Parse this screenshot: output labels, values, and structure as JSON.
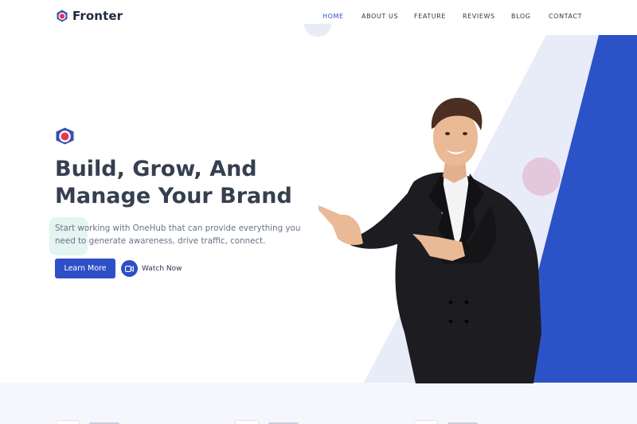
{
  "brand": {
    "name": "Fronter",
    "icon": "hexagon-logo-icon"
  },
  "nav": {
    "items": [
      {
        "label": "HOME",
        "active": true
      },
      {
        "label": "ABOUT US",
        "active": false
      },
      {
        "label": "FEATURE",
        "active": false
      },
      {
        "label": "REVIEWS",
        "active": false
      },
      {
        "label": "BLOG",
        "active": false
      },
      {
        "label": "CONTACT",
        "active": false
      }
    ]
  },
  "hero": {
    "title_line1": "Build, Grow, And",
    "title_line2": "Manage Your Brand",
    "description": "Start working with OneHub that can provide everything you need to generate awareness, drive traffic, connect.",
    "primary_button": "Learn More",
    "secondary_button": "Watch Now",
    "secondary_icon": "video-camera-icon"
  },
  "colors": {
    "accent": "#2e50c6",
    "heading": "#353f50",
    "body_text": "#687385",
    "light_band": "#e8ebf8",
    "logo_red": "#e5394a"
  }
}
